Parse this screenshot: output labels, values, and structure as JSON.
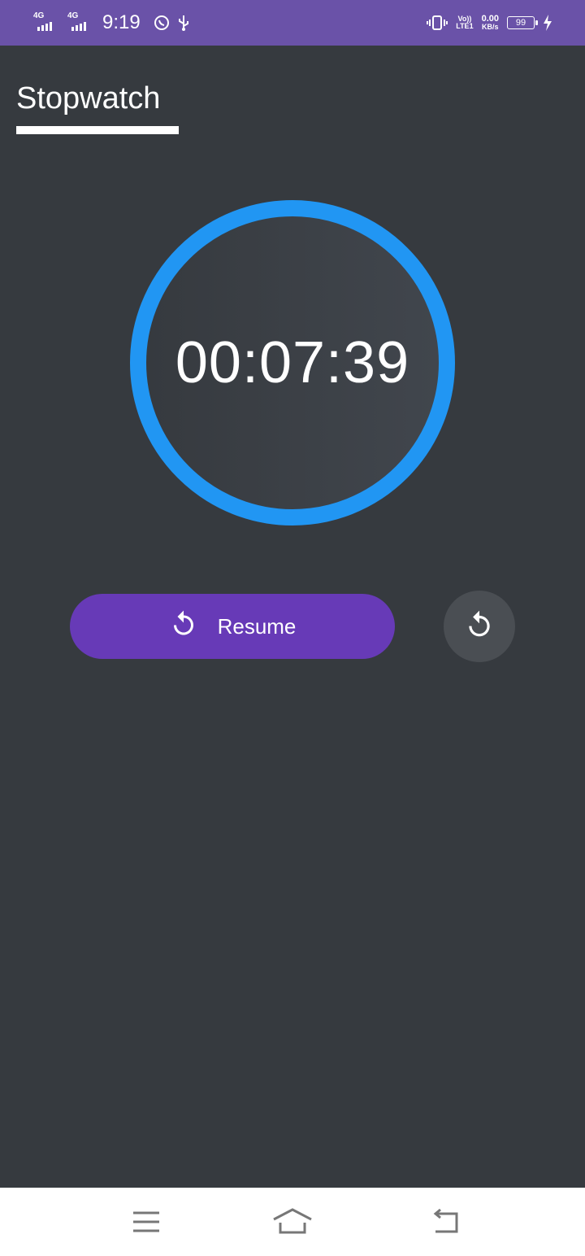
{
  "status_bar": {
    "network1_label": "4G",
    "network2_label": "4G",
    "time": "9:19",
    "volte_label": "Vo))",
    "lte_label": "LTE1",
    "speed_value": "0.00",
    "speed_unit": "KB/s",
    "battery_level": "99",
    "icons": [
      "signal-icon",
      "whatsapp-icon",
      "usb-icon",
      "vibrate-icon",
      "charging-icon"
    ]
  },
  "header": {
    "title": "Stopwatch"
  },
  "stopwatch": {
    "elapsed": "00:07:39",
    "ring_color": "#2196f3"
  },
  "controls": {
    "resume_label": "Resume",
    "resume_color": "#673ab7",
    "resume_icon": "restart-icon",
    "reset_icon": "reset-icon"
  },
  "nav_bar": {
    "icons": [
      "menu-icon",
      "home-icon",
      "back-icon"
    ]
  }
}
